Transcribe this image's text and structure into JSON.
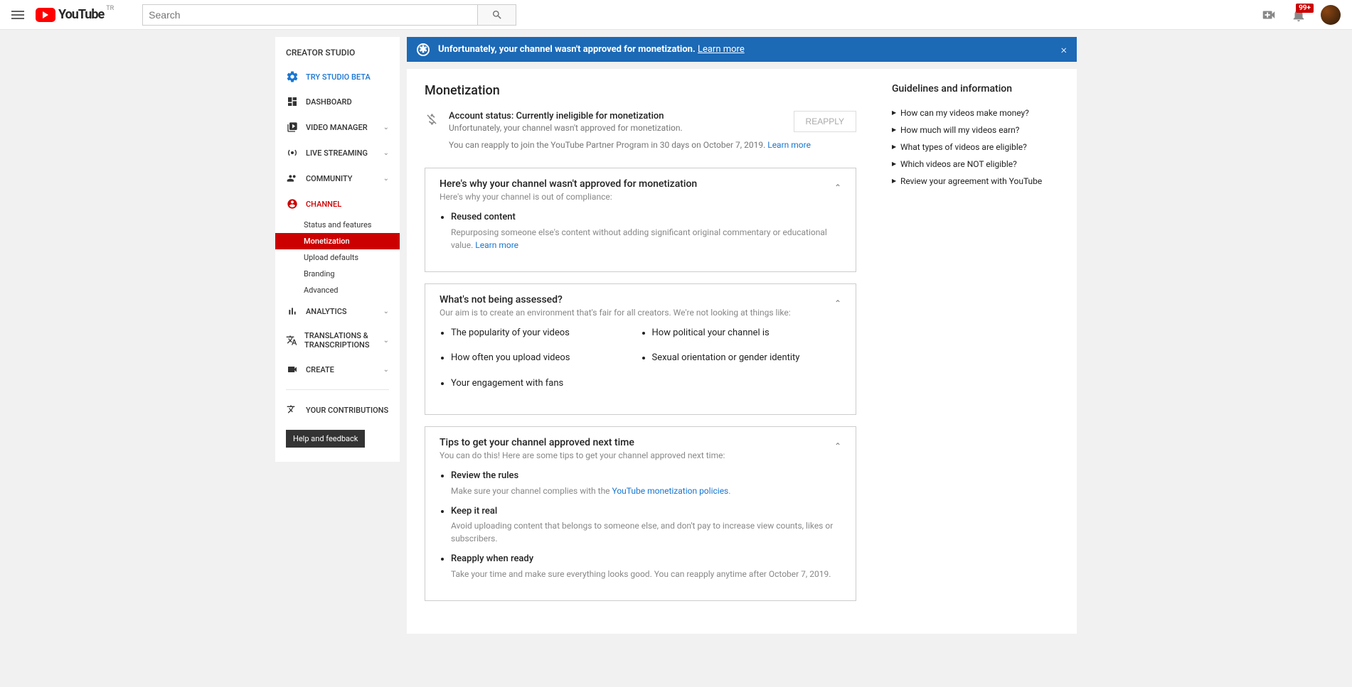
{
  "header": {
    "logo_text": "YouTube",
    "country_code": "TR",
    "search_placeholder": "Search",
    "notification_badge": "99+"
  },
  "sidebar": {
    "title": "CREATOR STUDIO",
    "beta_label": "TRY STUDIO BETA",
    "items": [
      {
        "label": "DASHBOARD"
      },
      {
        "label": "VIDEO MANAGER"
      },
      {
        "label": "LIVE STREAMING"
      },
      {
        "label": "COMMUNITY"
      },
      {
        "label": "CHANNEL"
      },
      {
        "label": "ANALYTICS"
      },
      {
        "label": "TRANSLATIONS & TRANSCRIPTIONS"
      },
      {
        "label": "CREATE"
      }
    ],
    "channel_sub": [
      "Status and features",
      "Monetization",
      "Upload defaults",
      "Branding",
      "Advanced"
    ],
    "contributions": "YOUR CONTRIBUTIONS",
    "help": "Help and feedback"
  },
  "banner": {
    "text": "Unfortunately, your channel wasn't approved for monetization.",
    "link": "Learn more"
  },
  "page": {
    "title": "Monetization",
    "status_title": "Account status: Currently ineligible for monetization",
    "status_sub": "Unfortunately, your channel wasn't approved for monetization.",
    "reapply_btn": "REAPPLY",
    "reapply_text": "You can reapply to join the YouTube Partner Program in 30 days on October 7, 2019.",
    "reapply_link": "Learn more"
  },
  "card1": {
    "title": "Here's why your channel wasn't approved for monetization",
    "sub": "Here's why your channel is out of compliance:",
    "item_title": "Reused content",
    "item_desc": "Repurposing someone else's content without adding significant original commentary or educational value. ",
    "item_link": "Learn more"
  },
  "card2": {
    "title": "What's not being assessed?",
    "sub": "Our aim is to create an environment that's fair for all creators. We're not looking at things like:",
    "col1": [
      "The popularity of your videos",
      "How often you upload videos",
      "Your engagement with fans"
    ],
    "col2": [
      "How political your channel is",
      "Sexual orientation or gender identity"
    ]
  },
  "card3": {
    "title": "Tips to get your channel approved next time",
    "sub": "You can do this! Here are some tips to get your channel approved next time:",
    "items": [
      {
        "t": "Review the rules",
        "d_pre": "Make sure your channel complies with the ",
        "link": "YouTube monetization policies",
        "d_post": "."
      },
      {
        "t": "Keep it real",
        "d": "Avoid uploading content that belongs to someone else, and don't pay to increase view counts, likes or subscribers."
      },
      {
        "t": "Reapply when ready",
        "d": "Take your time and make sure everything looks good. You can reapply anytime after October 7, 2019."
      }
    ]
  },
  "guidelines": {
    "title": "Guidelines and information",
    "items": [
      "How can my videos make money?",
      "How much will my videos earn?",
      "What types of videos are eligible?",
      "Which videos are NOT eligible?",
      "Review your agreement with YouTube"
    ]
  }
}
